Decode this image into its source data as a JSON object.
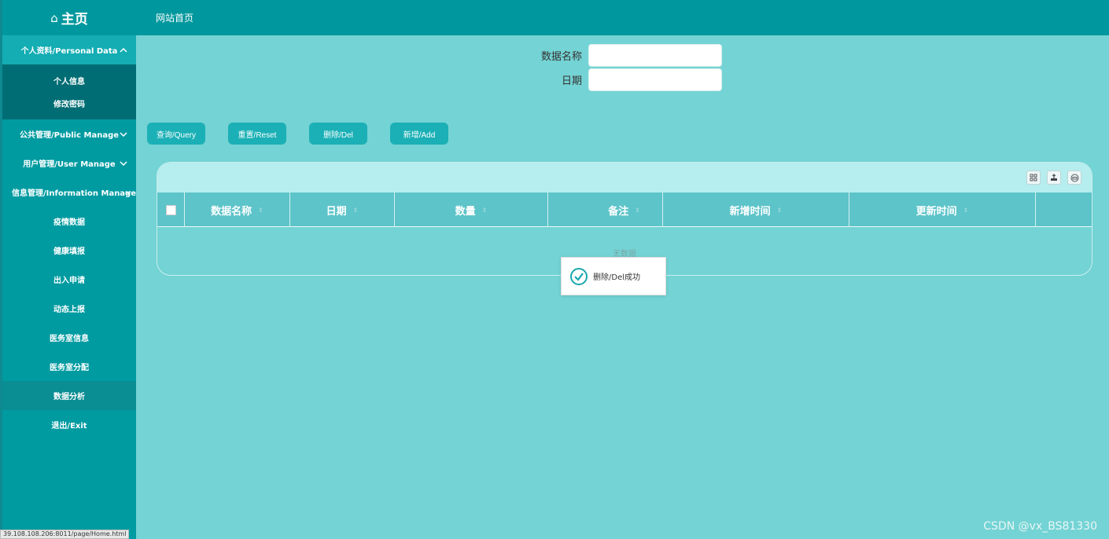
{
  "sidebar": {
    "brand": "主页",
    "menu": [
      {
        "label": "个人资料/Personal Data"
      },
      {
        "label": "个人信息"
      },
      {
        "label": "修改密码"
      },
      {
        "label": "公共管理/Public Manage"
      },
      {
        "label": "用户管理/User Manage"
      },
      {
        "label": "信息管理/Information Manage"
      },
      {
        "label": "疫情数据"
      },
      {
        "label": "健康填报"
      },
      {
        "label": "出入申请"
      },
      {
        "label": "动态上报"
      },
      {
        "label": "医务室信息"
      },
      {
        "label": "医务室分配"
      },
      {
        "label": "数据分析"
      },
      {
        "label": "退出/Exit"
      }
    ]
  },
  "topbar": {
    "title": "网站首页"
  },
  "search": {
    "name_label": "数据名称",
    "name_value": "",
    "date_label": "日期",
    "date_value": ""
  },
  "buttons": {
    "query": "查询/Query",
    "reset": "重置/Reset",
    "delete": "删除/Del",
    "add": "新增/Add"
  },
  "table": {
    "columns": [
      "数据名称",
      "日期",
      "数量",
      "备注",
      "新增时间",
      "更新时间"
    ],
    "empty_text": "无数据"
  },
  "toast": {
    "message": "删除/Del成功"
  },
  "status_url": "39.108.108.206:8011/page/Home.html",
  "watermark": "CSDN @vx_BS81330"
}
